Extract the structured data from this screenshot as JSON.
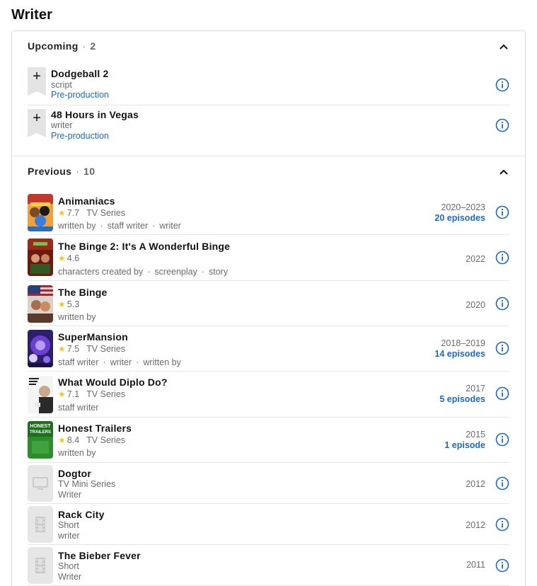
{
  "title": "Writer",
  "colors": {
    "link": "#1a6bc4",
    "star": "#f5c518",
    "icon": "#1a6bc4"
  },
  "upcoming": {
    "label": "Upcoming",
    "count": "2",
    "items": [
      {
        "title": "Dodgeball 2",
        "role": "script",
        "status": "Pre-production"
      },
      {
        "title": "48 Hours in Vegas",
        "role": "writer",
        "status": "Pre-production"
      }
    ]
  },
  "previous": {
    "label": "Previous",
    "count": "10",
    "items": [
      {
        "title": "Animaniacs",
        "rating": "7.7",
        "type": "TV Series",
        "credits": [
          "written by",
          "staff writer",
          "writer"
        ],
        "years": "2020–2023",
        "episodes": "20 episodes",
        "poster": "animaniacs-poster"
      },
      {
        "title": "The Binge 2: It's A Wonderful Binge",
        "rating": "4.6",
        "type": "",
        "credits": [
          "characters created by",
          "screenplay",
          "story"
        ],
        "years": "2022",
        "episodes": "",
        "poster": "binge2-poster"
      },
      {
        "title": "The Binge",
        "rating": "5.3",
        "type": "",
        "credits": [
          "written by"
        ],
        "years": "2020",
        "episodes": "",
        "poster": "binge-poster"
      },
      {
        "title": "SuperMansion",
        "rating": "7.5",
        "type": "TV Series",
        "credits": [
          "staff writer",
          "writer",
          "written by"
        ],
        "years": "2018–2019",
        "episodes": "14 episodes",
        "poster": "supermansion-poster"
      },
      {
        "title": "What Would Diplo Do?",
        "rating": "7.1",
        "type": "TV Series",
        "credits": [
          "staff writer"
        ],
        "years": "2017",
        "episodes": "5 episodes",
        "poster": "diplo-poster"
      },
      {
        "title": "Honest Trailers",
        "rating": "8.4",
        "type": "TV Series",
        "credits": [
          "written by"
        ],
        "years": "2015",
        "episodes": "1 episode",
        "poster": "honest-trailers-poster",
        "poster_text": "HONEST\nTRAILERS"
      },
      {
        "title": "Dogtor",
        "type": "TV Mini Series",
        "role": "Writer",
        "years": "2012",
        "placeholder": "tv-icon"
      },
      {
        "title": "Rack City",
        "type": "Short",
        "role": "writer",
        "years": "2012",
        "placeholder": "film-icon"
      },
      {
        "title": "The Bieber Fever",
        "type": "Short",
        "role": "Writer",
        "years": "2011",
        "placeholder": "film-icon"
      }
    ]
  }
}
